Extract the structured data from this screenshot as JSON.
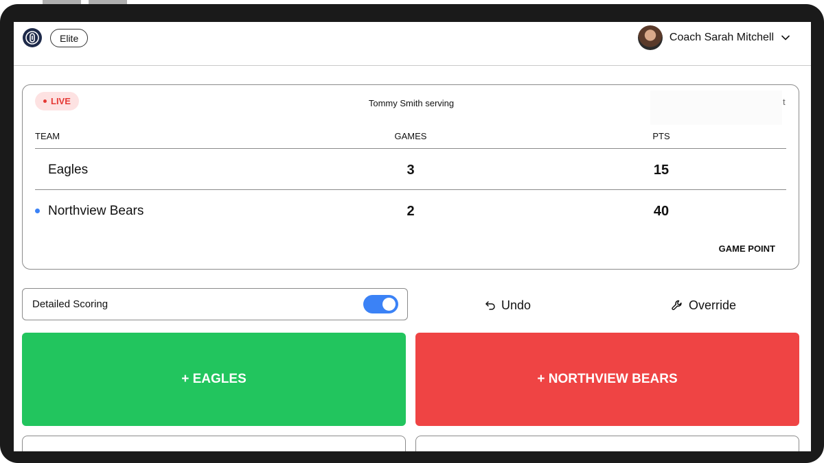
{
  "header": {
    "tier_badge": "Elite",
    "user_name": "Coach Sarah Mitchell"
  },
  "scoreboard": {
    "live_label": "LIVE",
    "serving_text": "Tommy Smith serving",
    "partial_text": "t",
    "columns": {
      "team": "TEAM",
      "games": "GAMES",
      "points": "PTS"
    },
    "teams": [
      {
        "name": "Eagles",
        "games": "3",
        "points": "15",
        "serving": false
      },
      {
        "name": "Northview Bears",
        "games": "2",
        "points": "40",
        "serving": true
      }
    ],
    "status": "GAME POINT"
  },
  "controls": {
    "detailed_scoring_label": "Detailed Scoring",
    "detailed_scoring_on": true,
    "undo_label": "Undo",
    "override_label": "Override"
  },
  "score_buttons": {
    "eagles": "+ EAGLES",
    "bears": "+ NORTHVIEW BEARS"
  },
  "colors": {
    "accent": "#3b82f6",
    "eagles": "#22c55e",
    "bears": "#ef4444",
    "live": "#e53935"
  }
}
